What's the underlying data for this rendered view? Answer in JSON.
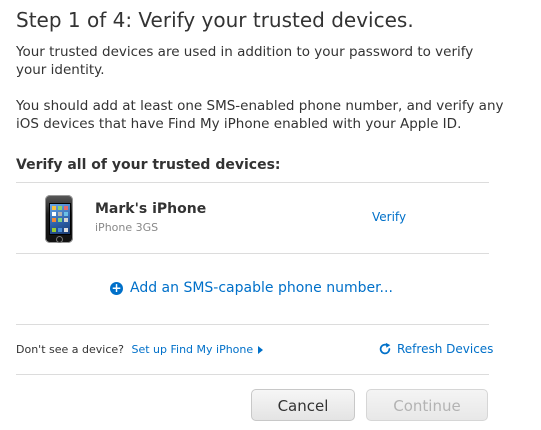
{
  "header": {
    "title": "Step 1 of 4: Verify your trusted devices."
  },
  "intro": {
    "paragraph1": "Your trusted devices are used in addition to your password to verify your identity.",
    "paragraph2": "You should add at least one SMS-enabled phone number, and verify any iOS devices that have Find My iPhone enabled with your Apple ID."
  },
  "devices": {
    "heading": "Verify all of your trusted devices:",
    "items": [
      {
        "name": "Mark's iPhone",
        "model": "iPhone 3GS",
        "action_label": "Verify",
        "icon": "iphone-icon"
      }
    ],
    "add_sms_label": "Add an SMS-capable phone number...",
    "add_icon": "plus-circle-icon"
  },
  "footer": {
    "missing_prompt": "Don't see a device?",
    "setup_link": "Set up Find My iPhone",
    "refresh_label": "Refresh Devices",
    "refresh_icon": "refresh-icon"
  },
  "actions": {
    "cancel_label": "Cancel",
    "continue_label": "Continue"
  },
  "colors": {
    "link": "#0070c9",
    "text": "#333333",
    "muted": "#888888",
    "disabled": "#b3b3b3"
  }
}
